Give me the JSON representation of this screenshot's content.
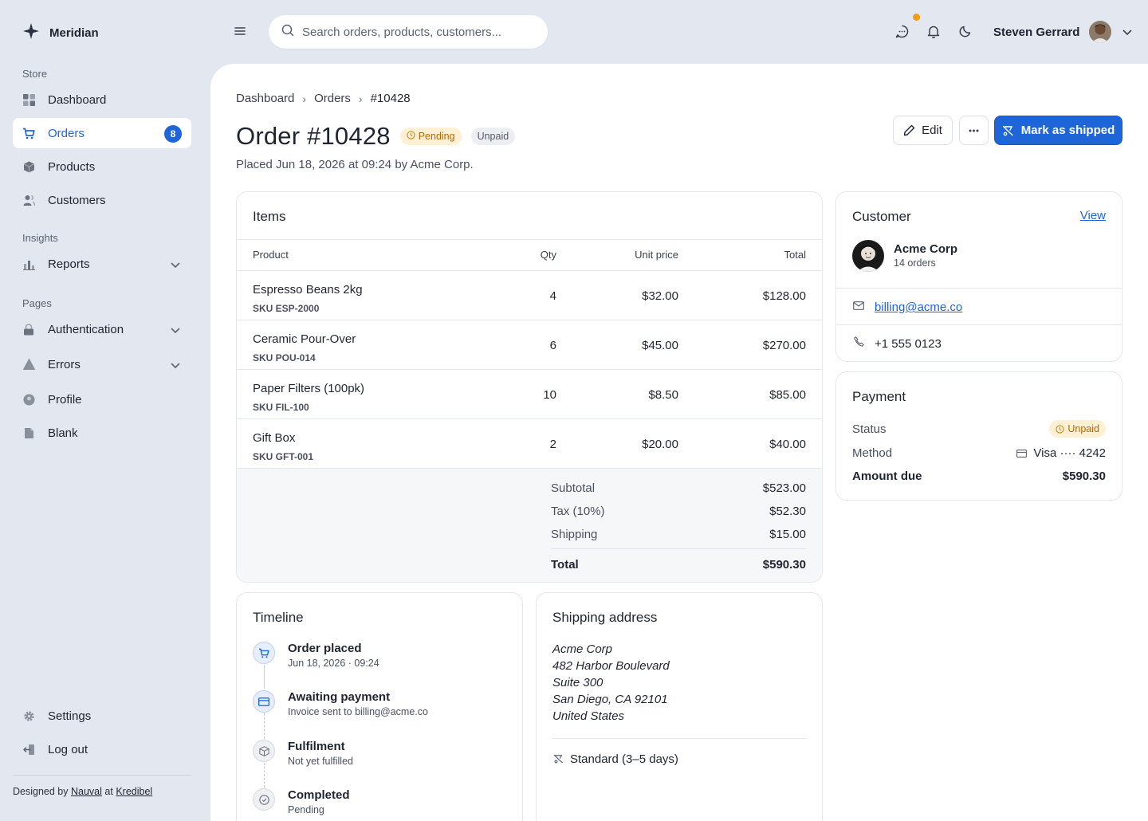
{
  "brand": {
    "name": "Meridian"
  },
  "sidebar": {
    "section_store": "Store",
    "section_insights": "Insights",
    "section_pages": "Pages",
    "items": [
      {
        "label": "Dashboard",
        "icon": "dashboard-icon"
      },
      {
        "label": "Orders",
        "icon": "cart-icon",
        "badge": "8",
        "active": true
      },
      {
        "label": "Products",
        "icon": "box-icon"
      },
      {
        "label": "Customers",
        "icon": "users-icon"
      },
      {
        "label": "Reports",
        "icon": "chart-icon",
        "expandable": true
      },
      {
        "label": "Authentication",
        "icon": "lock-icon",
        "expandable": true
      },
      {
        "label": "Errors",
        "icon": "warning-icon",
        "expandable": true
      },
      {
        "label": "Profile",
        "icon": "profile-icon"
      },
      {
        "label": "Blank",
        "icon": "page-icon"
      },
      {
        "label": "Settings",
        "icon": "gear-icon"
      },
      {
        "label": "Log out",
        "icon": "logout-icon"
      }
    ],
    "credits": {
      "prefix": "Designed by",
      "author": "Nauval",
      "middle": "at",
      "company": "Kredibel"
    }
  },
  "topbar": {
    "search_placeholder": "Search orders, products, customers...",
    "user_name": "Steven Gerrard"
  },
  "breadcrumb": [
    "Dashboard",
    "Orders",
    "#10428"
  ],
  "order": {
    "title": "Order #10428",
    "status_badge": "Pending",
    "payment_badge": "Unpaid",
    "placed": "Placed Jun 18, 2026 at 09:24 by Acme Corp.",
    "actions": {
      "edit": "Edit",
      "primary": "Mark as shipped"
    }
  },
  "items_card": {
    "title": "Items",
    "columns": [
      "Product",
      "Qty",
      "Unit price",
      "Total"
    ],
    "rows": [
      {
        "name": "Espresso Beans 2kg",
        "sku": "SKU ESP-2000",
        "qty": "4",
        "price": "$32.00",
        "total": "$128.00"
      },
      {
        "name": "Ceramic Pour-Over",
        "sku": "SKU POU-014",
        "qty": "6",
        "price": "$45.00",
        "total": "$270.00"
      },
      {
        "name": "Paper Filters (100pk)",
        "sku": "SKU FIL-100",
        "qty": "10",
        "price": "$8.50",
        "total": "$85.00"
      },
      {
        "name": "Gift Box",
        "sku": "SKU GFT-001",
        "qty": "2",
        "price": "$20.00",
        "total": "$40.00"
      }
    ],
    "summary": {
      "subtotal_label": "Subtotal",
      "subtotal": "$523.00",
      "tax_label": "Tax (10%)",
      "tax": "$52.30",
      "shipping_label": "Shipping",
      "shipping": "$15.00",
      "total_label": "Total",
      "total": "$590.30"
    }
  },
  "customer_card": {
    "title": "Customer",
    "view_link": "View",
    "name": "Acme Corp",
    "orders": "14 orders",
    "email": "billing@acme.co",
    "phone": "+1 555 0123"
  },
  "payment_card": {
    "title": "Payment",
    "status_label": "Status",
    "status": "Unpaid",
    "method_label": "Method",
    "method": "Visa ···· 4242",
    "due_label": "Amount due",
    "due": "$590.30"
  },
  "timeline_card": {
    "title": "Timeline",
    "events": [
      {
        "title": "Order placed",
        "sub": "Jun 18, 2026 · 09:24",
        "icon": "cart-icon"
      },
      {
        "title": "Awaiting payment",
        "sub": "Invoice sent to billing@acme.co",
        "icon": "credit-card-icon"
      },
      {
        "title": "Fulfilment",
        "sub": "Not yet fulfilled",
        "icon": "box-icon"
      },
      {
        "title": "Completed",
        "sub": "Pending",
        "icon": "check-circle-icon"
      }
    ]
  },
  "shipping_card": {
    "title": "Shipping address",
    "address": [
      "Acme Corp",
      "482 Harbor Boulevard",
      "Suite 300",
      "San Diego, CA 92101",
      "United States"
    ],
    "method": "Standard (3–5 days)"
  },
  "colors": {
    "accent": "#1e66d8",
    "pending": "#b26a00",
    "notification": "#f39c12",
    "sidebar_bg": "#e3e7ef"
  }
}
